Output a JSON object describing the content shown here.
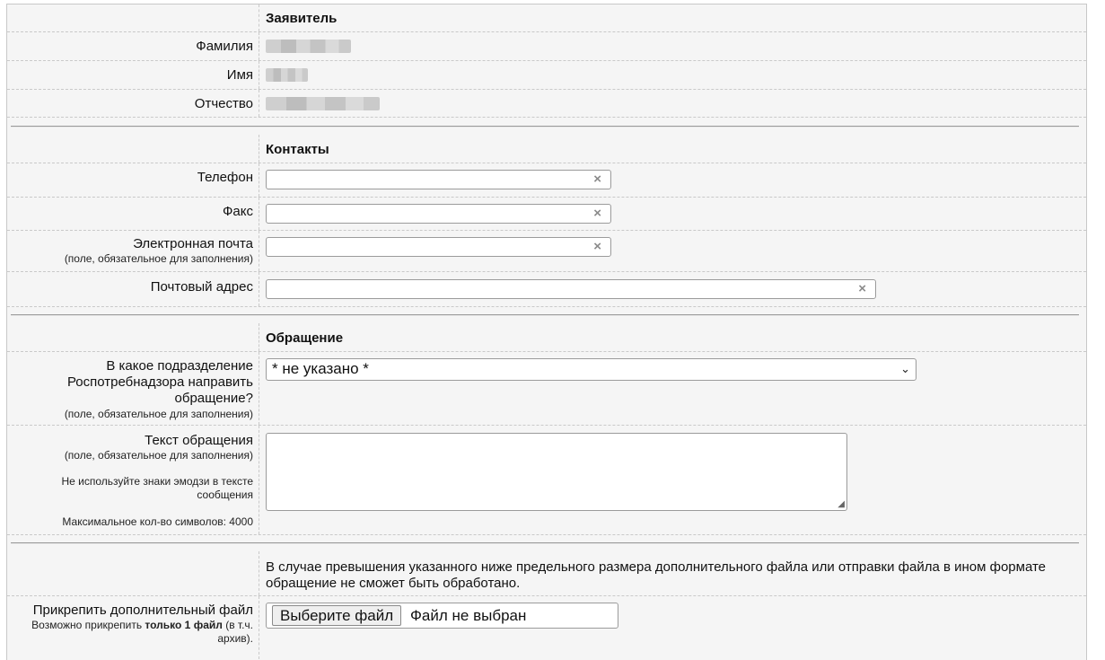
{
  "applicant": {
    "title": "Заявитель",
    "last_name_label": "Фамилия",
    "first_name_label": "Имя",
    "patronymic_label": "Отчество"
  },
  "contacts": {
    "title": "Контакты",
    "phone_label": "Телефон",
    "fax_label": "Факс",
    "email_label": "Электронная почта",
    "email_note": "(поле, обязательное для заполнения)",
    "address_label": "Почтовый адрес",
    "clear_icon": "×"
  },
  "request": {
    "title": "Обращение",
    "department_label": "В какое подразделение Роспотребнадзора направить обращение?",
    "department_note": "(поле, обязательное для заполнения)",
    "department_value": "* не указано *",
    "text_label": "Текст обращения",
    "text_note": "(поле, обязательное для заполнения)",
    "emoji_note": "Не используйте знаки эмодзи в тексте сообщения",
    "max_chars_note": "Максимальное кол-во символов: 4000"
  },
  "attachment": {
    "warning": "В случае превышения указанного ниже предельного размера дополнительного файла или отправки файла в ином формате обращение не сможет быть обработано.",
    "label": "Прикрепить дополнительный файл",
    "note_prefix": "Возможно прикрепить ",
    "note_bold": "только 1 файл",
    "note_suffix": " (в т.ч. архив).",
    "choose_button": "Выберите файл",
    "file_status": "Файл не выбран"
  }
}
